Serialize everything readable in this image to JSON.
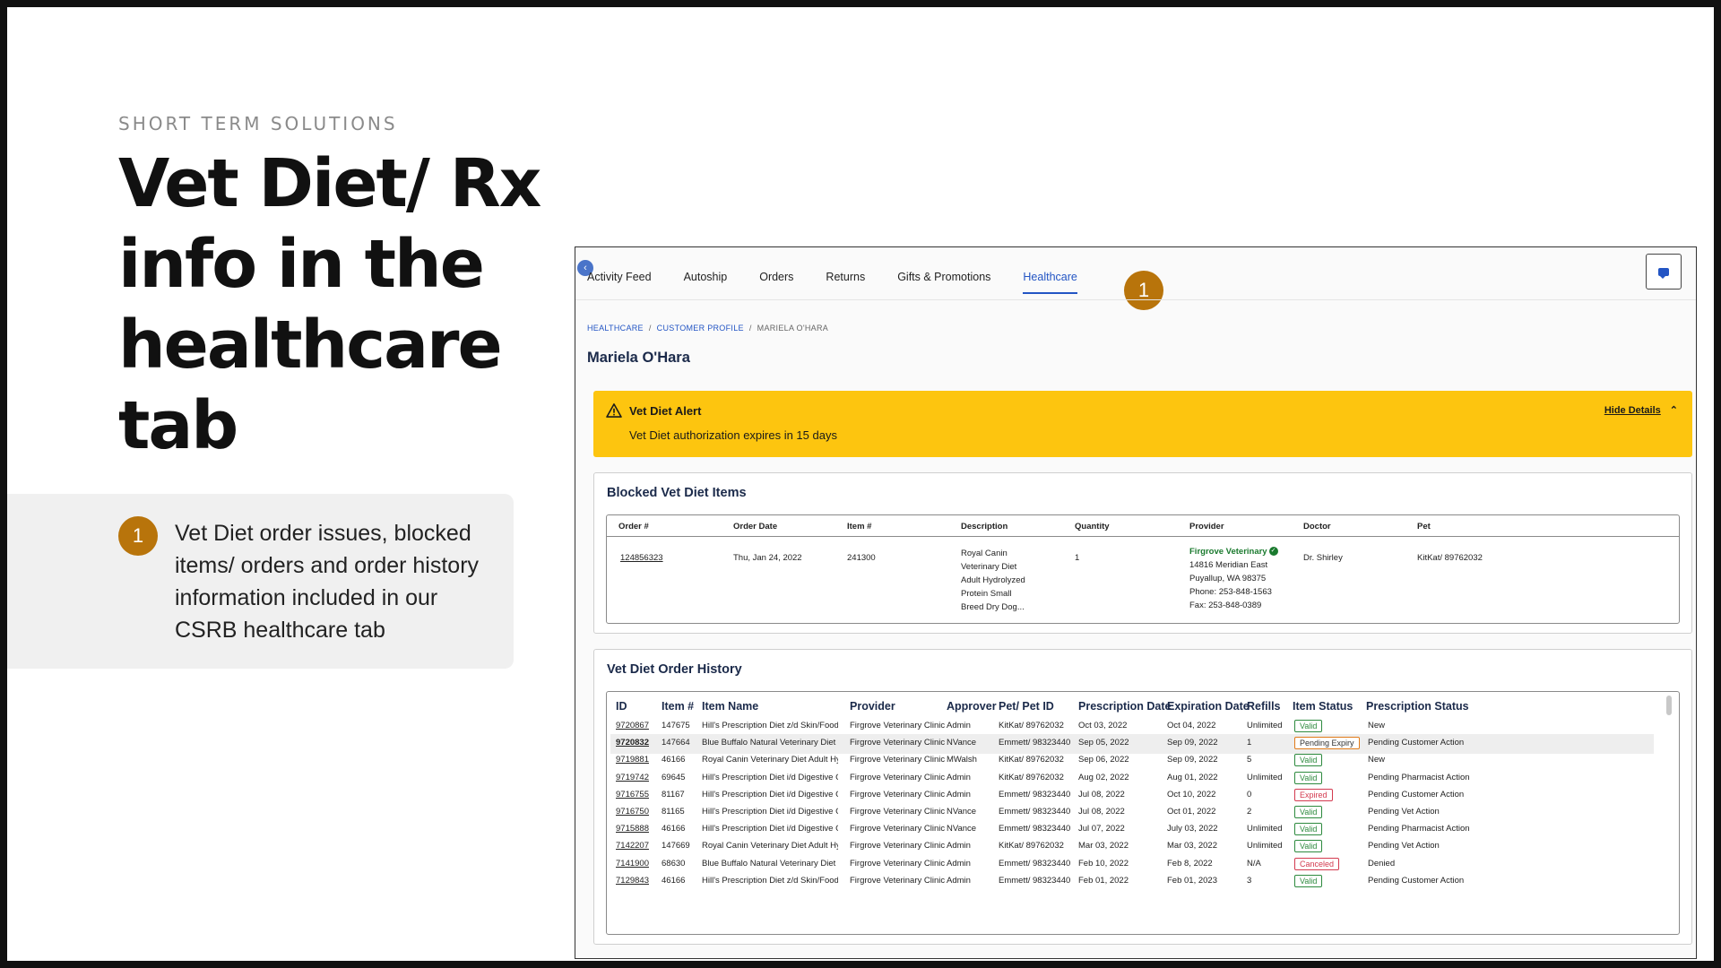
{
  "slide": {
    "eyebrow": "SHORT TERM SOLUTIONS",
    "headline": "Vet Diet/ Rx info in the healthcare tab",
    "callout_number": "1",
    "callout_text": "Vet Diet order issues, blocked items/ orders and order history information included in our CSRB healthcare tab",
    "accent_color": "#b8740b"
  },
  "app": {
    "tabs": [
      {
        "label": "Activity Feed"
      },
      {
        "label": "Autoship"
      },
      {
        "label": "Orders"
      },
      {
        "label": "Returns"
      },
      {
        "label": "Gifts & Promotions"
      },
      {
        "label": "Healthcare"
      }
    ],
    "active_tab": "Healthcare",
    "annotation_badge": "1",
    "breadcrumb": [
      "HEALTHCARE",
      "CUSTOMER PROFILE",
      "MARIELA O'HARA"
    ],
    "customer_name": "Mariela O'Hara",
    "alert": {
      "title": "Vet Diet Alert",
      "message": "Vet Diet authorization expires in 15 days",
      "toggle": "Hide Details",
      "color": "#fdc50f"
    },
    "blocked": {
      "title": "Blocked Vet Diet Items",
      "headers": [
        "Order #",
        "Order Date",
        "Item #",
        "Description",
        "Quantity",
        "Provider",
        "Doctor",
        "Pet"
      ],
      "row": {
        "order": "124856323",
        "date": "Thu, Jan 24, 2022",
        "item": "241300",
        "description": [
          "Royal Canin",
          "Veterinary Diet",
          "Adult Hydrolyzed",
          "Protein Small",
          "Breed Dry Dog..."
        ],
        "quantity": "1",
        "provider_name": "Firgrove Veterinary",
        "provider_address": [
          "14816 Meridian East",
          "Puyallup, WA 98375",
          "Phone: 253-848-1563",
          "Fax: 253-848-0389"
        ],
        "doctor": "Dr. Shirley",
        "pet": "KitKat/ 89762032"
      }
    },
    "history": {
      "title": "Vet Diet Order History",
      "headers": [
        "ID",
        "Item #",
        "Item Name",
        "Provider",
        "Approver",
        "Pet/ Pet ID",
        "Prescription Date",
        "Expiration Date",
        "Refills",
        "Item Status",
        "Prescription  Status"
      ],
      "rows": [
        {
          "id": "9720867",
          "item": "147675",
          "name": "Hill's Prescription Diet z/d Skin/Food S...",
          "provider": "Firgrove Veterinary Clinic",
          "approver": "Admin",
          "pet": "KitKat/ 89762032",
          "rx_date": "Oct 03, 2022",
          "exp_date": "Oct 04, 2022",
          "refills": "Unlimited",
          "item_status": "Valid",
          "rx_status": "New"
        },
        {
          "id": "9720832",
          "item": "147664",
          "name": "Blue Buffalo Natural Veterinary Diet K...",
          "provider": "Firgrove Veterinary Clinic",
          "approver": "NVance",
          "pet": "Emmett/ 98323440",
          "rx_date": "Sep 05, 2022",
          "exp_date": "Sep 09, 2022",
          "refills": "1",
          "item_status": "Pending Expiry",
          "rx_status": "Pending Customer Action"
        },
        {
          "id": "9719881",
          "item": "46166",
          "name": "Royal Canin Veterinary Diet Adult Hydr...",
          "provider": "Firgrove Veterinary Clinic",
          "approver": "MWalsh",
          "pet": "KitKat/ 89762032",
          "rx_date": "Sep 06, 2022",
          "exp_date": "Sep 09, 2022",
          "refills": "5",
          "item_status": "Valid",
          "rx_status": "New"
        },
        {
          "id": "9719742",
          "item": "69645",
          "name": "Hill's Prescription Diet i/d Digestive C...",
          "provider": "Firgrove Veterinary Clinic",
          "approver": "Admin",
          "pet": "KitKat/ 89762032",
          "rx_date": "Aug 02, 2022",
          "exp_date": "Aug 01, 2022",
          "refills": "Unlimited",
          "item_status": "Valid",
          "rx_status": "Pending Pharmacist Action"
        },
        {
          "id": "9716755",
          "item": "81167",
          "name": "Hill's Prescription Diet i/d Digestive C...",
          "provider": "Firgrove Veterinary Clinic",
          "approver": "Admin",
          "pet": "Emmett/ 98323440",
          "rx_date": "Jul 08, 2022",
          "exp_date": "Oct 10, 2022",
          "refills": "0",
          "item_status": "Expired",
          "rx_status": "Pending Customer Action"
        },
        {
          "id": "9716750",
          "item": "81165",
          "name": "Hill's Prescription Diet i/d Digestive C...",
          "provider": "Firgrove Veterinary Clinic",
          "approver": "NVance",
          "pet": "Emmett/ 98323440",
          "rx_date": "Jul 08, 2022",
          "exp_date": "Oct 01, 2022",
          "refills": "2",
          "item_status": "Valid",
          "rx_status": "Pending Vet Action"
        },
        {
          "id": "9715888",
          "item": "46166",
          "name": "Hill's Prescription Diet i/d Digestive C...",
          "provider": "Firgrove Veterinary Clinic",
          "approver": "NVance",
          "pet": "Emmett/ 98323440",
          "rx_date": "Jul 07, 2022",
          "exp_date": "July 03, 2022",
          "refills": "Unlimited",
          "item_status": "Valid",
          "rx_status": "Pending Pharmacist Action"
        },
        {
          "id": "7142207",
          "item": "147669",
          "name": "Royal Canin Veterinary Diet Adult Hydr...",
          "provider": "Firgrove Veterinary Clinic",
          "approver": "Admin",
          "pet": "KitKat/ 89762032",
          "rx_date": "Mar 03, 2022",
          "exp_date": "Mar 03, 2022",
          "refills": "Unlimited",
          "item_status": "Valid",
          "rx_status": "Pending Vet Action"
        },
        {
          "id": "7141900",
          "item": "68630",
          "name": "Blue Buffalo Natural Veterinary Diet H...",
          "provider": "Firgrove Veterinary Clinic",
          "approver": "Admin",
          "pet": "Emmett/ 98323440",
          "rx_date": "Feb 10, 2022",
          "exp_date": "Feb 8, 2022",
          "refills": "N/A",
          "item_status": "Canceled",
          "rx_status": "Denied"
        },
        {
          "id": "7129843",
          "item": "46166",
          "name": "Hill's Prescription Diet z/d Skin/Food S...",
          "provider": "Firgrove Veterinary Clinic",
          "approver": "Admin",
          "pet": "Emmett/ 98323440",
          "rx_date": "Feb 01, 2022",
          "exp_date": "Feb 01, 2023",
          "refills": "3",
          "item_status": "Valid",
          "rx_status": "Pending Customer Action"
        }
      ]
    }
  }
}
